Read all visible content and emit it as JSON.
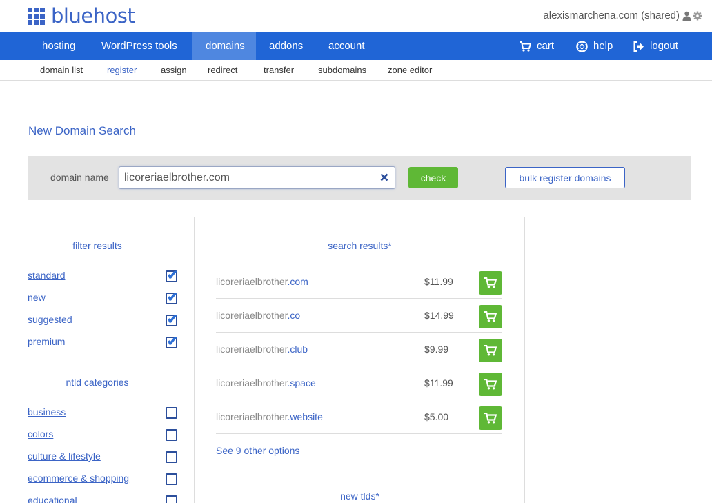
{
  "brand": {
    "name": "bluehost"
  },
  "account": {
    "label": "alexismarchena.com (shared)",
    "user_icon": "user-icon",
    "settings_icon": "gear-icon"
  },
  "nav": {
    "items": [
      {
        "label": "hosting"
      },
      {
        "label": "WordPress tools"
      },
      {
        "label": "domains",
        "active": true
      },
      {
        "label": "addons"
      },
      {
        "label": "account"
      }
    ],
    "right": [
      {
        "label": "cart",
        "icon": "cart-icon"
      },
      {
        "label": "help",
        "icon": "lifebuoy-icon"
      },
      {
        "label": "logout",
        "icon": "logout-icon"
      }
    ]
  },
  "subnav": {
    "items": [
      {
        "label": "domain list"
      },
      {
        "label": "register",
        "active": true
      },
      {
        "label": "assign"
      },
      {
        "label": "redirect"
      },
      {
        "label": "transfer"
      },
      {
        "label": "subdomains"
      },
      {
        "label": "zone editor"
      }
    ]
  },
  "page": {
    "title": "New Domain Search"
  },
  "search": {
    "label": "domain name",
    "value": "licoreriaelbrother.com",
    "check_label": "check",
    "bulk_label": "bulk register domains"
  },
  "filters": {
    "title": "filter results",
    "items": [
      {
        "label": "standard",
        "checked": true
      },
      {
        "label": "new",
        "checked": true
      },
      {
        "label": "suggested",
        "checked": true
      },
      {
        "label": "premium",
        "checked": true
      }
    ]
  },
  "categories": {
    "title": "ntld categories",
    "items": [
      {
        "label": "business",
        "checked": false
      },
      {
        "label": "colors",
        "checked": false
      },
      {
        "label": "culture & lifestyle",
        "checked": false
      },
      {
        "label": "ecommerce & shopping",
        "checked": false
      },
      {
        "label": "educational",
        "checked": false
      }
    ]
  },
  "results": {
    "title": "search results*",
    "items": [
      {
        "name": "licoreriaelbrother",
        "tld": ".com",
        "price": "$11.99"
      },
      {
        "name": "licoreriaelbrother",
        "tld": ".co",
        "price": "$14.99"
      },
      {
        "name": "licoreriaelbrother",
        "tld": ".club",
        "price": "$9.99"
      },
      {
        "name": "licoreriaelbrother",
        "tld": ".space",
        "price": "$11.99"
      },
      {
        "name": "licoreriaelbrother",
        "tld": ".website",
        "price": "$5.00"
      }
    ],
    "see_more": "See 9 other options",
    "new_tlds_title": "new tlds*"
  },
  "colors": {
    "brand_blue": "#2065d6",
    "link_blue": "#3b64c6",
    "green": "#5fb836"
  }
}
